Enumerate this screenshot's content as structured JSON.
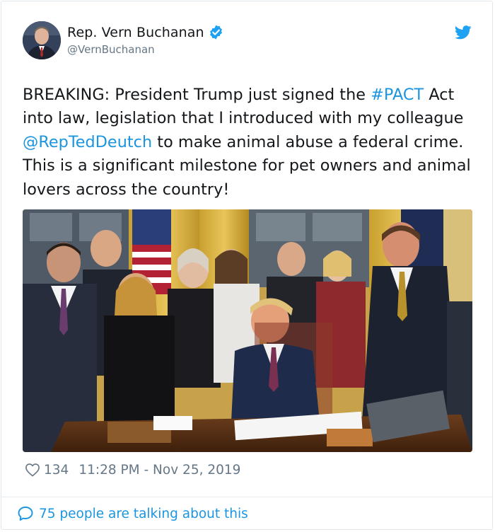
{
  "author": {
    "name": "Rep. Vern Buchanan",
    "handle": "@VernBuchanan",
    "verified": true,
    "avatar_icon": "avatar-photo"
  },
  "tweet": {
    "segments": [
      {
        "text": "BREAKING: President Trump just signed the ",
        "type": "text"
      },
      {
        "text": "#PACT",
        "type": "hashtag"
      },
      {
        "text": " Act into law, legislation that I introduced with my colleague ",
        "type": "text"
      },
      {
        "text": "@RepTedDeutch",
        "type": "mention"
      },
      {
        "text": " to make animal abuse a federal crime. This is a significant milestone for pet owners and animal lovers across the country!",
        "type": "text"
      }
    ]
  },
  "meta": {
    "likes": "134",
    "timestamp": "11:28 PM - Nov 25, 2019"
  },
  "footer": {
    "talking_text": "75 people are talking about this"
  },
  "colors": {
    "link": "#1b95e0",
    "muted": "#657786",
    "text": "#14171a",
    "verified": "#1da1f2",
    "twitter_bird": "#1da1f2"
  },
  "icons": [
    "twitter-bird-icon",
    "verified-badge-icon",
    "heart-icon",
    "speech-bubble-icon"
  ]
}
